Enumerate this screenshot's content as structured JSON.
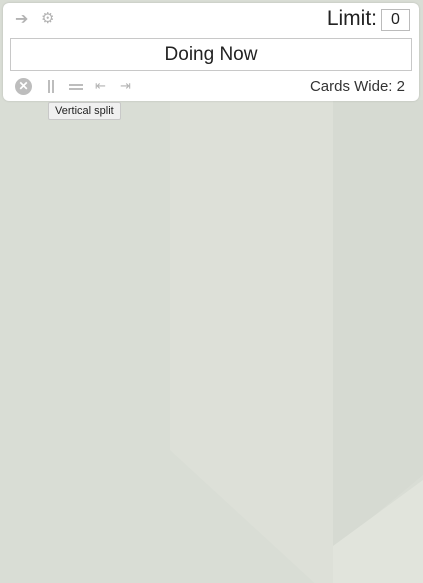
{
  "column": {
    "limit_label": "Limit:",
    "limit_value": "0",
    "title": "Doing Now",
    "cards_wide_text": "Cards Wide: 2"
  },
  "icons": {
    "move": "arrow-right-icon",
    "settings": "gear-icon",
    "delete": "close-circle-icon",
    "vertical_split": "vertical-split-icon",
    "horizontal_split": "horizontal-split-icon",
    "move_left": "move-left-icon",
    "move_right": "move-right-icon"
  },
  "tooltip": {
    "text": "Vertical split"
  }
}
